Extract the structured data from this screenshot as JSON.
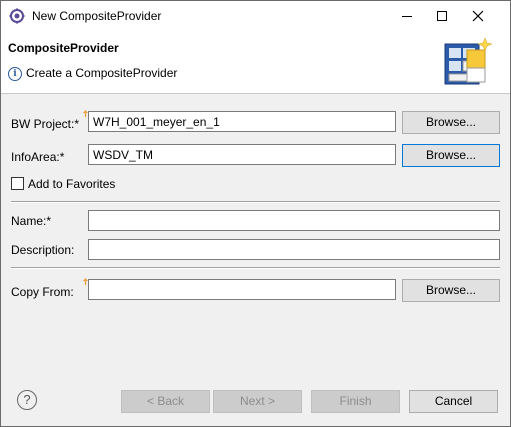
{
  "window": {
    "title": "New CompositeProvider"
  },
  "banner": {
    "title": "CompositeProvider",
    "message": "Create a CompositeProvider"
  },
  "form": {
    "bw_project_label": "BW Project:*",
    "bw_project_value": "W7H_001_meyer_en_1",
    "infoarea_label": "InfoArea:*",
    "infoarea_value": "WSDV_TM",
    "browse_label": "Browse...",
    "favorites_label": "Add to Favorites",
    "favorites_checked": false,
    "name_label": "Name:*",
    "name_value": "",
    "description_label": "Description:",
    "description_value": "",
    "copy_from_label": "Copy From:",
    "copy_from_value": ""
  },
  "buttons": {
    "back": "< Back",
    "next": "Next >",
    "finish": "Finish",
    "cancel": "Cancel"
  },
  "icons": {
    "app": "eclipse-gear-icon",
    "info": "info-icon",
    "wizard": "composite-provider-wizard-icon",
    "help": "help-icon",
    "content_assist": "content-assist-marker-icon"
  },
  "colors": {
    "focus_border": "#0078d7",
    "marker": "#e8a33c"
  }
}
